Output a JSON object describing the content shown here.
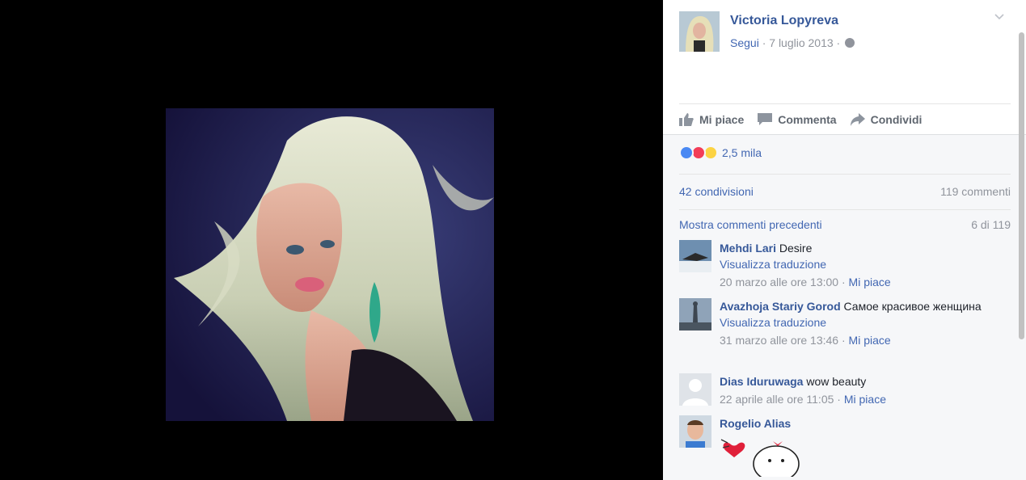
{
  "post": {
    "author": "Victoria Lopyreva",
    "follow": "Segui",
    "sep1": " · ",
    "date": "7 luglio 2013",
    "sep2": " · "
  },
  "actions": {
    "like": "Mi piace",
    "comment": "Commenta",
    "share": "Condividi"
  },
  "reactions": {
    "count": "2,5 mila"
  },
  "stats": {
    "shares": "42 condivisioni",
    "comments": "119 commenti"
  },
  "comments_header": {
    "more": "Mostra commenti precedenti",
    "count": "6 di 119"
  },
  "comments": [
    {
      "name": "Mehdi Lari",
      "text": "Desire",
      "translate": "Visualizza traduzione",
      "date": "20 marzo alle ore 13:00",
      "sep": " · ",
      "like": "Mi piace"
    },
    {
      "name": "Avazhoja Stariy Gorod",
      "text": "Самое красивое женщина",
      "translate": "Visualizza traduzione",
      "date": "31 marzo alle ore 13:46",
      "sep": " · ",
      "like": "Mi piace"
    },
    {
      "name": "Dias Iduruwaga",
      "text": "wow beauty",
      "date": "22 aprile alle ore 11:05",
      "sep": " · ",
      "like": "Mi piace"
    },
    {
      "name": "Rogelio Alias"
    }
  ],
  "icons": {
    "chevron": "chevron-down-icon",
    "globe": "globe-icon",
    "like": "thumbs-up-icon",
    "comment": "comment-bubble-icon",
    "share": "share-arrow-icon",
    "sticker": "heart-sticker-icon"
  },
  "colors": {
    "link": "#365899",
    "accent": "#4267b2",
    "muted": "#90949c",
    "like": "#4a89f3",
    "love": "#f33e58",
    "wow": "#fcd343"
  }
}
